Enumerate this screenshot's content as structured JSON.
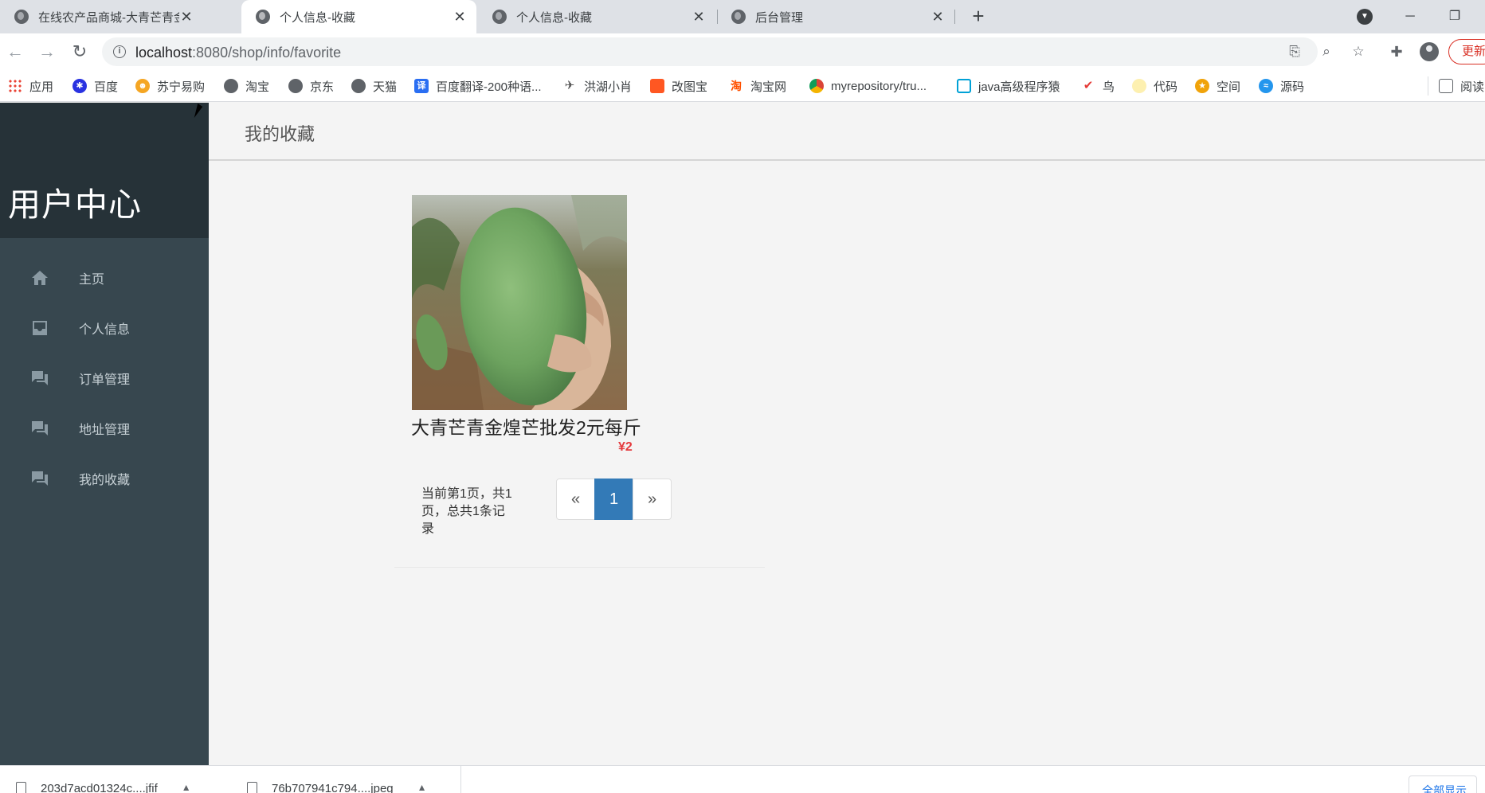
{
  "browser": {
    "tabs": [
      {
        "title": "在线农产品商城-大青芒青金煌芒"
      },
      {
        "title": "个人信息-收藏"
      },
      {
        "title": "个人信息-收藏"
      },
      {
        "title": "后台管理"
      }
    ],
    "new_tab": "+",
    "close_glyph": "✕",
    "url_host": "localhost",
    "url_path": ":8080/shop/info/favorite",
    "update_label": "更新",
    "window": {
      "minimize": "─",
      "restore": "❐"
    },
    "bookmarks": [
      {
        "label": "应用",
        "icon": "apps-grid-icon",
        "color": "#ea4335"
      },
      {
        "label": "百度",
        "icon": "baidu-paw-icon",
        "color": "#2932e1"
      },
      {
        "label": "苏宁易购",
        "icon": "suning-icon",
        "color": "#f5a623"
      },
      {
        "label": "淘宝",
        "icon": "globe-icon",
        "color": "#5f6368"
      },
      {
        "label": "京东",
        "icon": "globe-icon",
        "color": "#5f6368"
      },
      {
        "label": "天猫",
        "icon": "globe-icon",
        "color": "#5f6368"
      },
      {
        "label": "百度翻译-200种语...",
        "icon": "baidu-translate-icon",
        "color": "#2a6ef2",
        "glyph": "译"
      },
      {
        "label": "洪湖小肖",
        "icon": "bookmark-bird-icon",
        "color": "#555555"
      },
      {
        "label": "改图宝",
        "icon": "gaitubao-icon",
        "color": "#ff5722"
      },
      {
        "label": "淘宝网",
        "icon": "taobao-icon",
        "color": "#ff5000",
        "glyph": "淘"
      },
      {
        "label": "myrepository/tru...",
        "icon": "chrome-icon",
        "color": "#db4437"
      },
      {
        "label": "java高级程序猿",
        "icon": "bilibili-icon",
        "color": "#00a1d6"
      },
      {
        "label": "鸟",
        "icon": "bird-icon",
        "color": "#e53935"
      },
      {
        "label": "代码",
        "icon": "code-icon",
        "color": "#f6c744"
      },
      {
        "label": "空间",
        "icon": "qzone-icon",
        "color": "#f0a30a"
      },
      {
        "label": "源码",
        "icon": "docker-icon",
        "color": "#2496ed"
      },
      {
        "label": "阅读",
        "icon": "reading-list-icon",
        "color": "#5f6368"
      }
    ]
  },
  "sidebar": {
    "title": "用户中心",
    "items": [
      {
        "label": "主页",
        "icon": "home-icon"
      },
      {
        "label": "个人信息",
        "icon": "inbox-icon"
      },
      {
        "label": "订单管理",
        "icon": "chat-icon"
      },
      {
        "label": "地址管理",
        "icon": "chat-icon"
      },
      {
        "label": "我的收藏",
        "icon": "chat-icon"
      }
    ]
  },
  "main": {
    "heading": "我的收藏",
    "favorites": [
      {
        "name": "大青芒青金煌芒批发2元每斤",
        "price": "¥2",
        "image": "green-mango-in-hand"
      }
    ],
    "pagination": {
      "info": "当前第1页，共1页，总共1条记录",
      "prev": "«",
      "current": "1",
      "next": "»"
    }
  },
  "downloads": {
    "items": [
      {
        "name": "203d7acd01324c....jfif"
      },
      {
        "name": "76b707941c794....jpeg"
      }
    ],
    "show_all": "全部显示"
  }
}
